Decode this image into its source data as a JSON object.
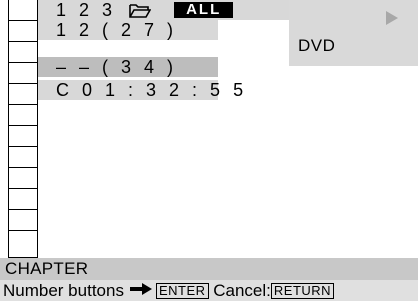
{
  "osd": {
    "row1": {
      "title_number": "1 2 3",
      "repeat_mode": "ALL"
    },
    "row2": {
      "text": "1 2 ( 2 7 )"
    },
    "row3": {
      "text": "– – ( 3 4 )"
    },
    "row4": {
      "text": "C   0 1 : 3 2 : 5 5"
    }
  },
  "right_panel": {
    "disc_type": "DVD",
    "icon": "play-icon"
  },
  "status": {
    "label": "CHAPTER"
  },
  "help": {
    "prefix": "Number buttons",
    "enter_key": "ENTER",
    "cancel_label": "Cancel:",
    "return_key": "RETURN"
  },
  "colors": {
    "panel_grey": "#d9d9d9",
    "selected_grey": "#bdbdbd",
    "status_grey": "#c8c8c8"
  }
}
